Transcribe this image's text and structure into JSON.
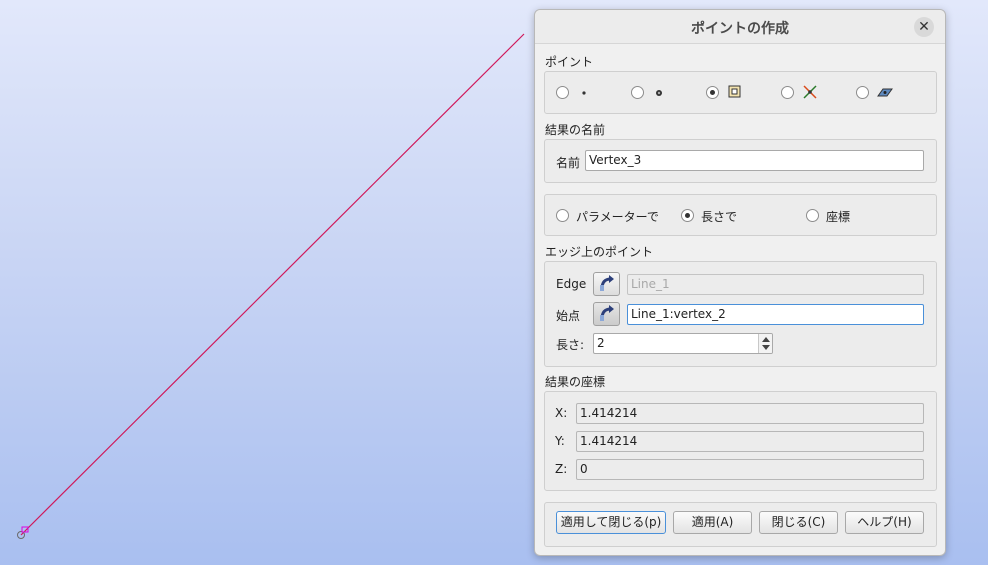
{
  "dialog": {
    "title": "ポイントの作成",
    "close_glyph": "✕",
    "point_section": {
      "label": "ポイント",
      "selected_type_index": 2
    },
    "result_name": {
      "section_label": "結果の名前",
      "field_label": "名前",
      "value": "Vertex_3"
    },
    "mode": {
      "options": [
        "パラメーターで",
        "長さで",
        "座標"
      ],
      "selected_index": 1
    },
    "on_edge": {
      "section_label": "エッジ上のポイント",
      "edge_label": "Edge",
      "edge_value": "Line_1",
      "start_label": "始点",
      "start_value": "Line_1:vertex_2",
      "length_label": "長さ:",
      "length_value": "2"
    },
    "coordinates": {
      "section_label": "結果の座標",
      "x_label": "X:",
      "x_value": "1.414214",
      "y_label": "Y:",
      "y_value": "1.414214",
      "z_label": "Z:",
      "z_value": "0"
    },
    "buttons": {
      "apply_close": "適用して閉じる(p)",
      "apply": "適用(A)",
      "close": "閉じる(C)",
      "help": "ヘルプ(H)"
    }
  },
  "icons": {
    "point_types": [
      "point-xyz-icon",
      "point-reference-icon",
      "point-on-edge-icon",
      "point-intersection-icon",
      "point-on-face-icon"
    ],
    "select": "edge-select-icon"
  },
  "colors": {
    "viewport_top": "#e2e8fb",
    "viewport_bottom": "#a9bff0",
    "line": "#d0185a",
    "focus": "#4a90d9"
  }
}
